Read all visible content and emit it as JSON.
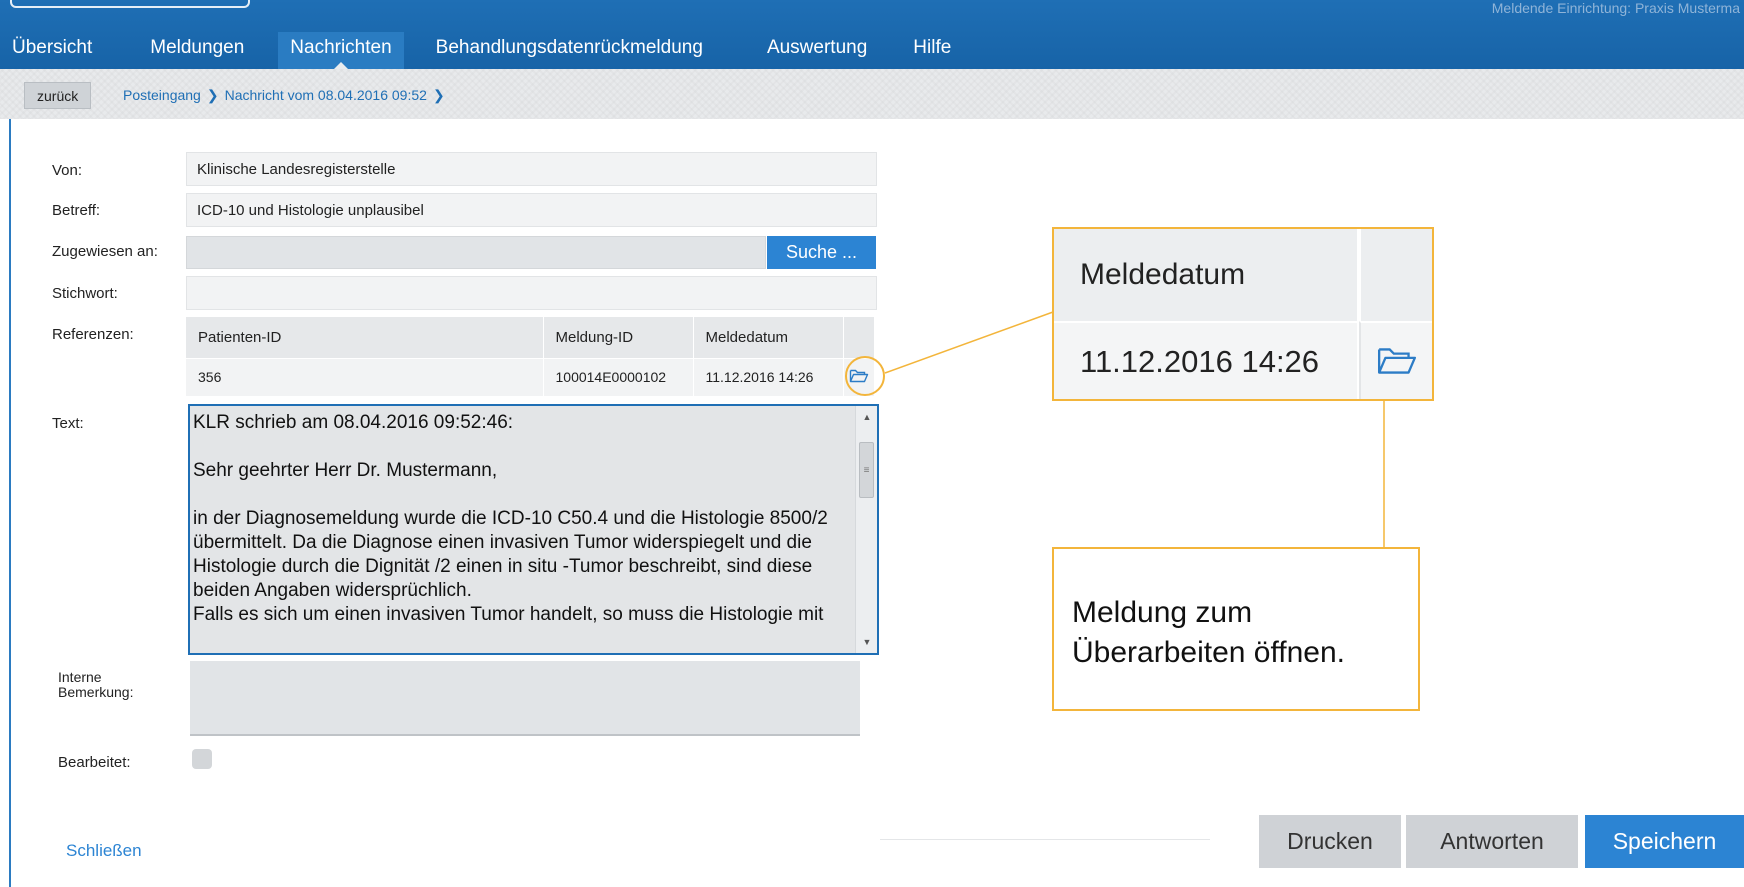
{
  "header": {
    "facility": "Meldende Einrichtung: Praxis Musterma",
    "nav": [
      "Übersicht",
      "Meldungen",
      "Nachrichten",
      "Behandlungsdatenrückmeldung",
      "Auswertung",
      "Hilfe"
    ],
    "active_tab": "Nachrichten"
  },
  "breadcrumb": {
    "back_label": "zurück",
    "items": [
      "Posteingang",
      "Nachricht vom 08.04.2016 09:52"
    ]
  },
  "form": {
    "labels": {
      "from": "Von:",
      "subject": "Betreff:",
      "assigned": "Zugewiesen an:",
      "keyword": "Stichwort:",
      "references": "Referenzen:",
      "text": "Text:",
      "remark_line1": "Interne",
      "remark_line2": "Bemerkung:",
      "processed": "Bearbeitet:"
    },
    "from": "Klinische Landesregisterstelle",
    "subject": "ICD-10 und Histologie unplausibel",
    "assigned": "",
    "keyword": "",
    "search_button": "Suche ...",
    "references": {
      "columns": [
        "Patienten-ID",
        "Meldung-ID",
        "Meldedatum"
      ],
      "rows": [
        [
          "356",
          "100014E0000102",
          "11.12.2016 14:26"
        ]
      ]
    },
    "text": "KLR schrieb am 08.04.2016 09:52:46:\n\nSehr geehrter Herr Dr. Mustermann,\n\nin der Diagnosemeldung wurde die ICD-10 C50.4 und die Histologie 8500/2 übermittelt. Da die Diagnose einen invasiven Tumor widerspiegelt und die Histologie durch die Dignität /2 einen in situ -Tumor beschreibt, sind diese beiden Angaben widersprüchlich.\nFalls es sich um einen invasiven Tumor handelt, so muss die Histologie mit",
    "remark": "",
    "processed": false
  },
  "footer": {
    "close": "Schließen",
    "print": "Drucken",
    "reply": "Antworten",
    "save": "Speichern"
  },
  "callout": {
    "zoom_header": "Meldedatum",
    "zoom_value": "11.12.2016 14:26",
    "note": "Meldung zum Überarbeiten öffnen.",
    "color": "#f3b53b"
  },
  "colors": {
    "nav_bar": "#1f6fb5",
    "accent": "#2c84d3"
  },
  "icons": [
    "folder-open-icon",
    "chevron-right-icon",
    "scroll-up-icon",
    "scroll-down-icon"
  ]
}
